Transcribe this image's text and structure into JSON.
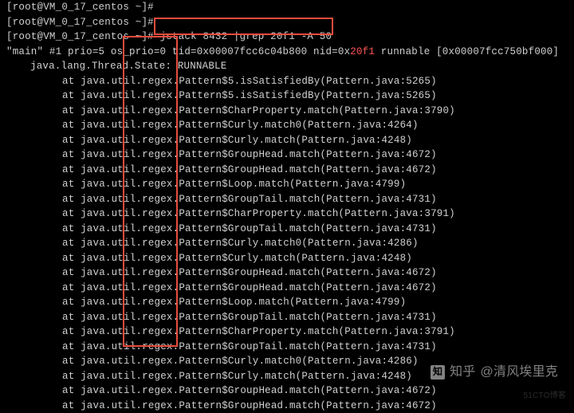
{
  "prompts": [
    {
      "user": "root",
      "host": "VM_0_17_centos",
      "dir": "~",
      "cmd": ""
    },
    {
      "user": "root",
      "host": "VM_0_17_centos",
      "dir": "~",
      "cmd": ""
    },
    {
      "user": "root",
      "host": "VM_0_17_centos",
      "dir": "~",
      "cmd": "jstack 8432 |grep 20f1 -A 50"
    }
  ],
  "thread_header": {
    "prefix": "\"main\" #1 prio=5 os_prio=0 tid=0x00007fcc6c04b800 nid=0x",
    "nid": "20f1",
    "suffix": " runnable [0x00007fcc750bf000]"
  },
  "thread_state": "java.lang.Thread.State: RUNNABLE",
  "stack": [
    "at java.util.regex.Pattern$5.isSatisfiedBy(Pattern.java:5265)",
    "at java.util.regex.Pattern$5.isSatisfiedBy(Pattern.java:5265)",
    "at java.util.regex.Pattern$CharProperty.match(Pattern.java:3790)",
    "at java.util.regex.Pattern$Curly.match0(Pattern.java:4264)",
    "at java.util.regex.Pattern$Curly.match(Pattern.java:4248)",
    "at java.util.regex.Pattern$GroupHead.match(Pattern.java:4672)",
    "at java.util.regex.Pattern$GroupHead.match(Pattern.java:4672)",
    "at java.util.regex.Pattern$Loop.match(Pattern.java:4799)",
    "at java.util.regex.Pattern$GroupTail.match(Pattern.java:4731)",
    "at java.util.regex.Pattern$CharProperty.match(Pattern.java:3791)",
    "at java.util.regex.Pattern$GroupTail.match(Pattern.java:4731)",
    "at java.util.regex.Pattern$Curly.match0(Pattern.java:4286)",
    "at java.util.regex.Pattern$Curly.match(Pattern.java:4248)",
    "at java.util.regex.Pattern$GroupHead.match(Pattern.java:4672)",
    "at java.util.regex.Pattern$GroupHead.match(Pattern.java:4672)",
    "at java.util.regex.Pattern$Loop.match(Pattern.java:4799)",
    "at java.util.regex.Pattern$GroupTail.match(Pattern.java:4731)",
    "at java.util.regex.Pattern$CharProperty.match(Pattern.java:3791)",
    "at java.util.regex.Pattern$GroupTail.match(Pattern.java:4731)",
    "at java.util.regex.Pattern$Curly.match0(Pattern.java:4286)",
    "at java.util.regex.Pattern$Curly.match(Pattern.java:4248)",
    "at java.util.regex.Pattern$GroupHead.match(Pattern.java:4672)",
    "at java.util.regex.Pattern$GroupHead.match(Pattern.java:4672)"
  ],
  "watermark": {
    "brand_short": "知",
    "brand": "知乎",
    "author": "@清风埃里克",
    "site": "51CTO博客"
  }
}
